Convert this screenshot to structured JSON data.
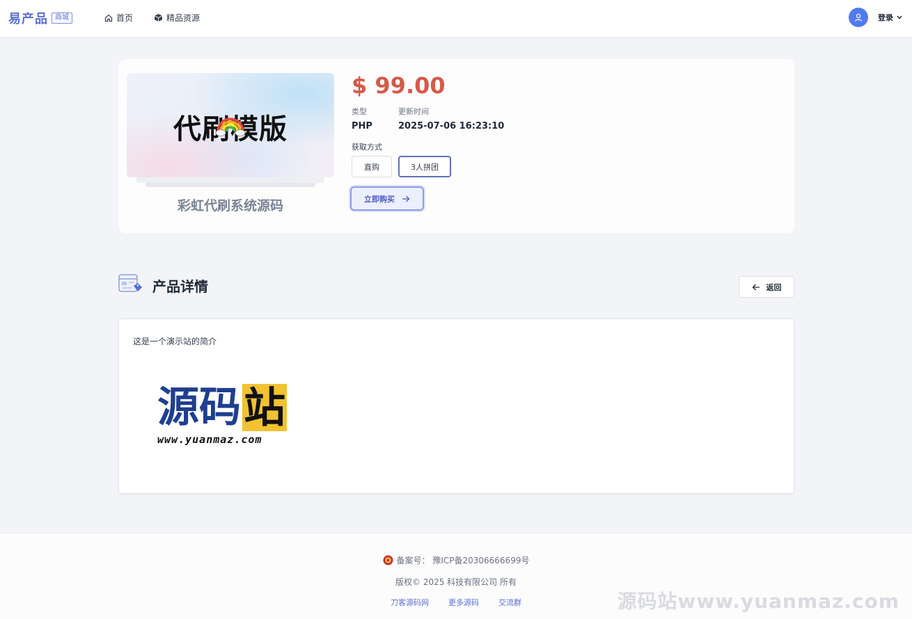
{
  "header": {
    "brand": "易产品",
    "brand_tag": "商城",
    "nav": [
      {
        "label": "首页",
        "icon": "home-icon"
      },
      {
        "label": "精品资源",
        "icon": "cube-icon"
      }
    ],
    "login_label": "登录"
  },
  "product": {
    "image_title": "代刷模版",
    "name": "彩虹代刷系统源码",
    "price": "$ 99.00",
    "type_label": "类型",
    "type_value": "PHP",
    "updated_label": "更新时间",
    "updated_value": "2025-07-06 16:23:10",
    "acquire_label": "获取方式",
    "options": [
      "直购",
      "3人拼团"
    ],
    "buy_label": "立即购买"
  },
  "details": {
    "title": "产品详情",
    "back_label": "返回",
    "intro": "这是一个演示站的简介",
    "logo_chars": [
      "源",
      "码",
      "站"
    ],
    "logo_url": "www.yuanmaz.com"
  },
  "footer": {
    "icp": "备案号： 豫ICP备20306666699号",
    "copyright": "版权© 2025 科技有限公司 所有",
    "links": [
      "刀客源码网",
      "更多源码",
      "交流群"
    ],
    "watermark": "源码站www.yuanmaz.com"
  },
  "colors": {
    "accent": "#5b6fd6",
    "price": "#d65a48",
    "logo_blue": "#1e3f8f",
    "logo_yellow": "#f2c230"
  }
}
